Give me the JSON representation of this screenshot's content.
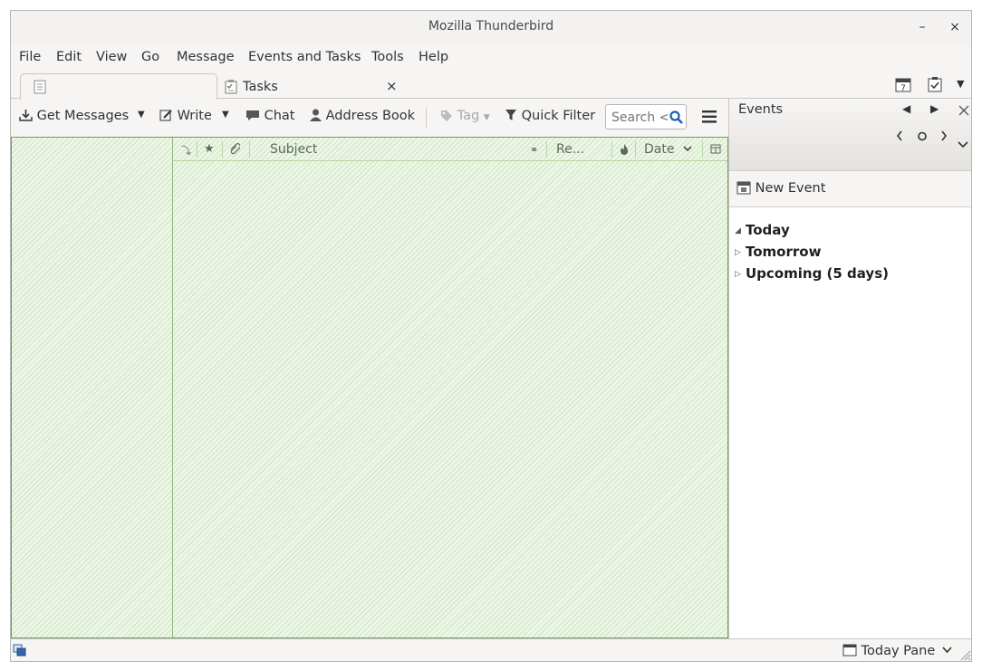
{
  "window": {
    "title": "Mozilla Thunderbird",
    "minimize_glyph": "–",
    "close_glyph": "×"
  },
  "menubar": [
    {
      "label": "File"
    },
    {
      "label": "Edit"
    },
    {
      "label": "View"
    },
    {
      "label": "Go"
    },
    {
      "label": "Message"
    },
    {
      "label": "Events and Tasks"
    },
    {
      "label": "Tools"
    },
    {
      "label": "Help"
    }
  ],
  "tabs": {
    "mail_tab_label": "",
    "tasks_tab_label": "Tasks",
    "tasks_close_glyph": "×"
  },
  "toolbar": {
    "get_messages": "Get Messages",
    "write": "Write",
    "chat": "Chat",
    "address_book": "Address Book",
    "tag": "Tag",
    "quick_filter": "Quick Filter",
    "search_placeholder": "Search <"
  },
  "thread_columns": {
    "subject": "Subject",
    "recipients": "Re...",
    "date": "Date"
  },
  "today_pane": {
    "title": "Events",
    "new_event": "New Event",
    "sections": [
      {
        "label": "Today",
        "expanded": true
      },
      {
        "label": "Tomorrow",
        "expanded": false
      },
      {
        "label": "Upcoming (5 days)",
        "expanded": false
      }
    ]
  },
  "statusbar": {
    "today_pane_label": "Today Pane"
  },
  "colors": {
    "content_green": "#e6f2dc",
    "content_border": "#6aa05a"
  }
}
